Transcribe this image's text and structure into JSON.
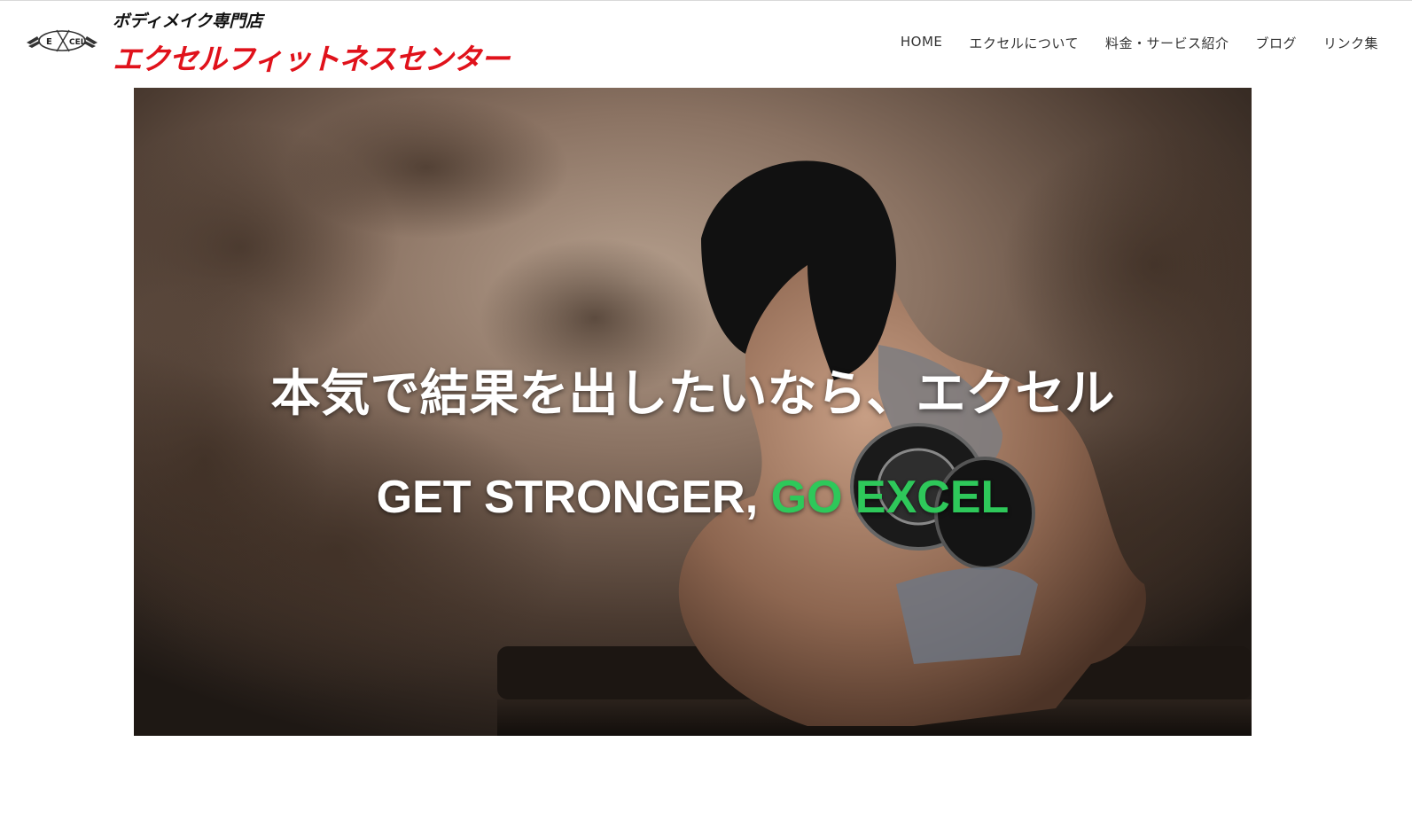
{
  "header": {
    "logo_text": "E XCEL",
    "tagline": "ボディメイク専門店",
    "brand_name": "エクセルフィットネスセンター"
  },
  "nav": {
    "items": [
      {
        "label": "HOME"
      },
      {
        "label": "エクセルについて"
      },
      {
        "label": "料金・サービス紹介"
      },
      {
        "label": "ブログ"
      },
      {
        "label": "リンク集"
      }
    ]
  },
  "hero": {
    "headline": "本気で結果を出したいなら、エクセル",
    "subline_white": "GET STRONGER, ",
    "subline_accent": "GO EXCEL"
  },
  "colors": {
    "brand_red": "#e0121b",
    "accent_green": "#2ec85a"
  }
}
